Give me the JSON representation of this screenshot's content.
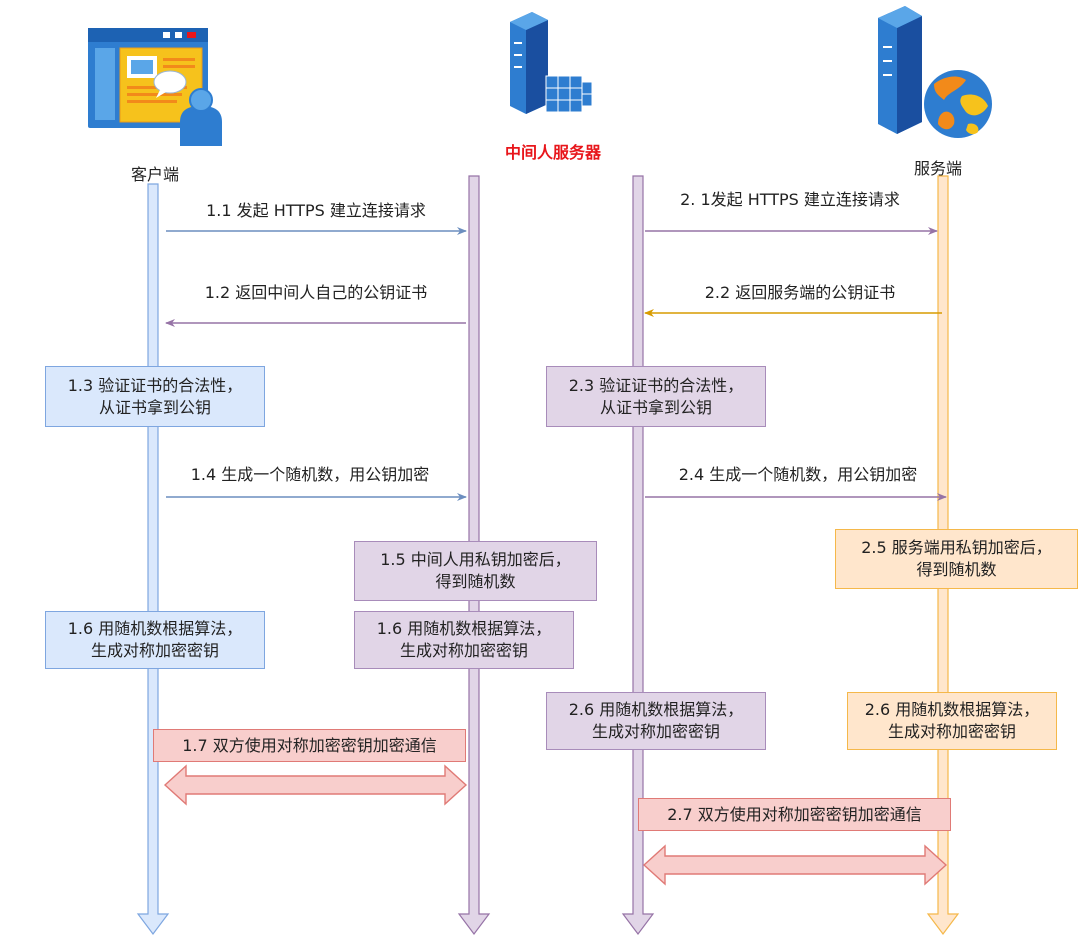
{
  "labels": {
    "client": "客户端",
    "mitm": "中间人服务器",
    "server": "服务端"
  },
  "messages": {
    "m1_1": "1.1 发起 HTTPS 建立连接请求",
    "m1_2": "1.2 返回中间人自己的公钥证书",
    "m1_4": "1.4 生成一个随机数，用公钥加密",
    "m2_1": "2. 1发起 HTTPS 建立连接请求",
    "m2_2": "2.2 返回服务端的公钥证书",
    "m2_4": "2.4 生成一个随机数，用公钥加密"
  },
  "boxes": {
    "b1_3": [
      "1.3 验证证书的合法性，",
      "从证书拿到公钥"
    ],
    "b2_3": [
      "2.3 验证证书的合法性，",
      "从证书拿到公钥"
    ],
    "b1_5": [
      "1.5 中间人用私钥加密后，",
      "得到随机数"
    ],
    "b2_5": [
      "2.5 服务端用私钥加密后，",
      "得到随机数"
    ],
    "b1_6_client": [
      "1.6 用随机数根据算法，",
      "生成对称加密密钥"
    ],
    "b1_6_mitm": [
      "1.6 用随机数根据算法，",
      "生成对称加密密钥"
    ],
    "b2_6_mitm": [
      "2.6 用随机数根据算法，",
      "生成对称加密密钥"
    ],
    "b2_6_server": [
      "2.6 用随机数根据算法，",
      "生成对称加密密钥"
    ],
    "b1_7": [
      "1.7 双方使用对称加密密钥加密通信"
    ],
    "b2_7": [
      "2.7 双方使用对称加密密钥加密通信"
    ]
  },
  "colors": {
    "blue_fill": "#dae8fc",
    "blue_stroke": "#7ea6e0",
    "blue_arrow": "#6c8ebf",
    "purple_fill": "#e1d5e7",
    "purple_stroke": "#a88cba",
    "purple_arrow": "#9673a6",
    "orange_fill": "#ffe6cc",
    "orange_stroke": "#f5b84a",
    "orange_arrow": "#d79b00",
    "red_fill": "#f8cecc",
    "red_stroke": "#e07a76",
    "mitm_label": "#e8161b"
  },
  "icons": {
    "client": "client-browser-user-icon",
    "mitm": "server-tower-grid-icon",
    "server": "server-tower-globe-icon"
  }
}
